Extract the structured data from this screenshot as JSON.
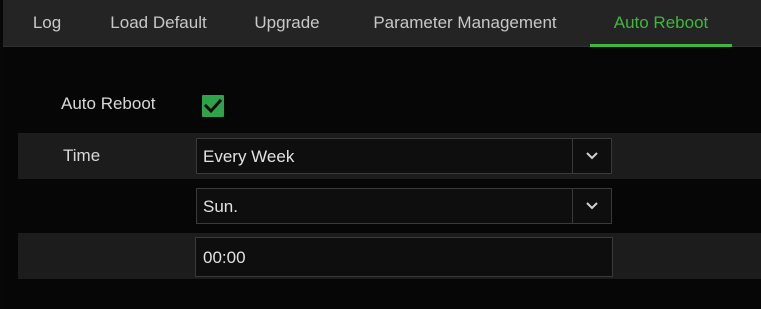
{
  "tabs": [
    {
      "label": "Log",
      "active": false
    },
    {
      "label": "Load Default",
      "active": false
    },
    {
      "label": "Upgrade",
      "active": false
    },
    {
      "label": "Parameter Management",
      "active": false
    },
    {
      "label": "Auto Reboot",
      "active": true
    }
  ],
  "colors": {
    "accent": "#3db83d",
    "checkbox": "#2fa34a",
    "background": "#060606",
    "band": "#1c1c1c"
  },
  "form": {
    "auto_reboot": {
      "label": "Auto Reboot",
      "checked": true,
      "icon": "checkmark-icon"
    },
    "time": {
      "label": "Time",
      "frequency": {
        "value": "Every Week",
        "icon": "chevron-down-icon"
      },
      "day": {
        "value": "Sun.",
        "icon": "chevron-down-icon"
      },
      "clock": {
        "value": "00:00"
      }
    }
  }
}
